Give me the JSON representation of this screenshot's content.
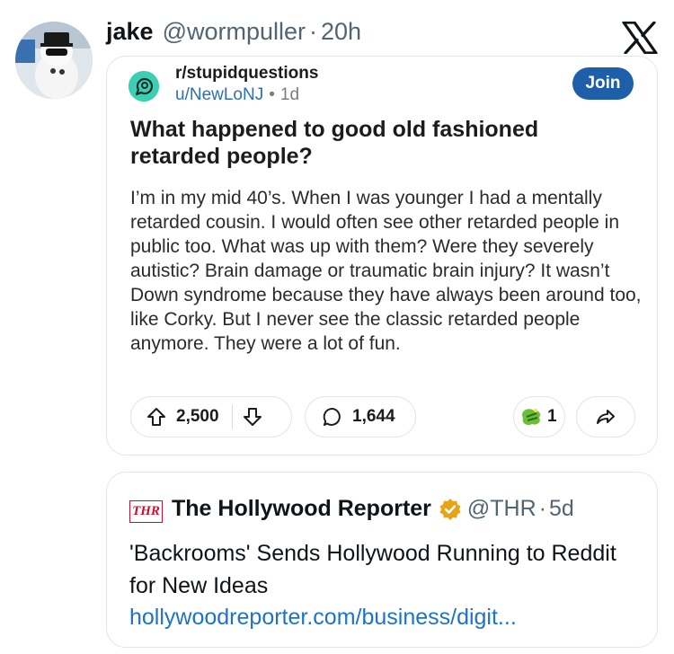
{
  "tweet": {
    "display_name": "jake",
    "handle": "@wormpuller",
    "separator": "·",
    "time": "20h",
    "avatar_icon": "bubble-avatar",
    "platform_icon": "x-logo-icon"
  },
  "reddit_post": {
    "subreddit": "r/stupidquestions",
    "user": "u/NewLoNJ",
    "separator": "•",
    "age": "1d",
    "join_label": "Join",
    "title": "What happened to good old fashioned retarded people?",
    "body": "I’m in my mid 40’s. When I was younger I had a mentally retarded cousin. I would often see other retarded people in public too. What was up with them? Were they severely autistic? Brain damage or traumatic brain injury? It wasn’t Down syndrome because they have always been around too, like Corky. But I never see the classic retarded people anymore. They were a lot of fun.",
    "upvotes": "2,500",
    "comments": "1,644",
    "awards": "1",
    "colors": {
      "join_bg": "#1d5fa8",
      "user_link": "#2a6fb5",
      "subreddit_icon": "#3bd0b3"
    }
  },
  "link_card": {
    "logo_text": "THR",
    "name": "The Hollywood Reporter",
    "handle": "@THR",
    "separator": "·",
    "time": "5d",
    "title": "'Backrooms' Sends Hollywood Running to Reddit for New Ideas",
    "url": "hollywoodreporter.com/business/digit...",
    "colors": {
      "verified_badge": "#e8a317",
      "url": "#1d73c8",
      "logo": "#c8102e"
    }
  }
}
